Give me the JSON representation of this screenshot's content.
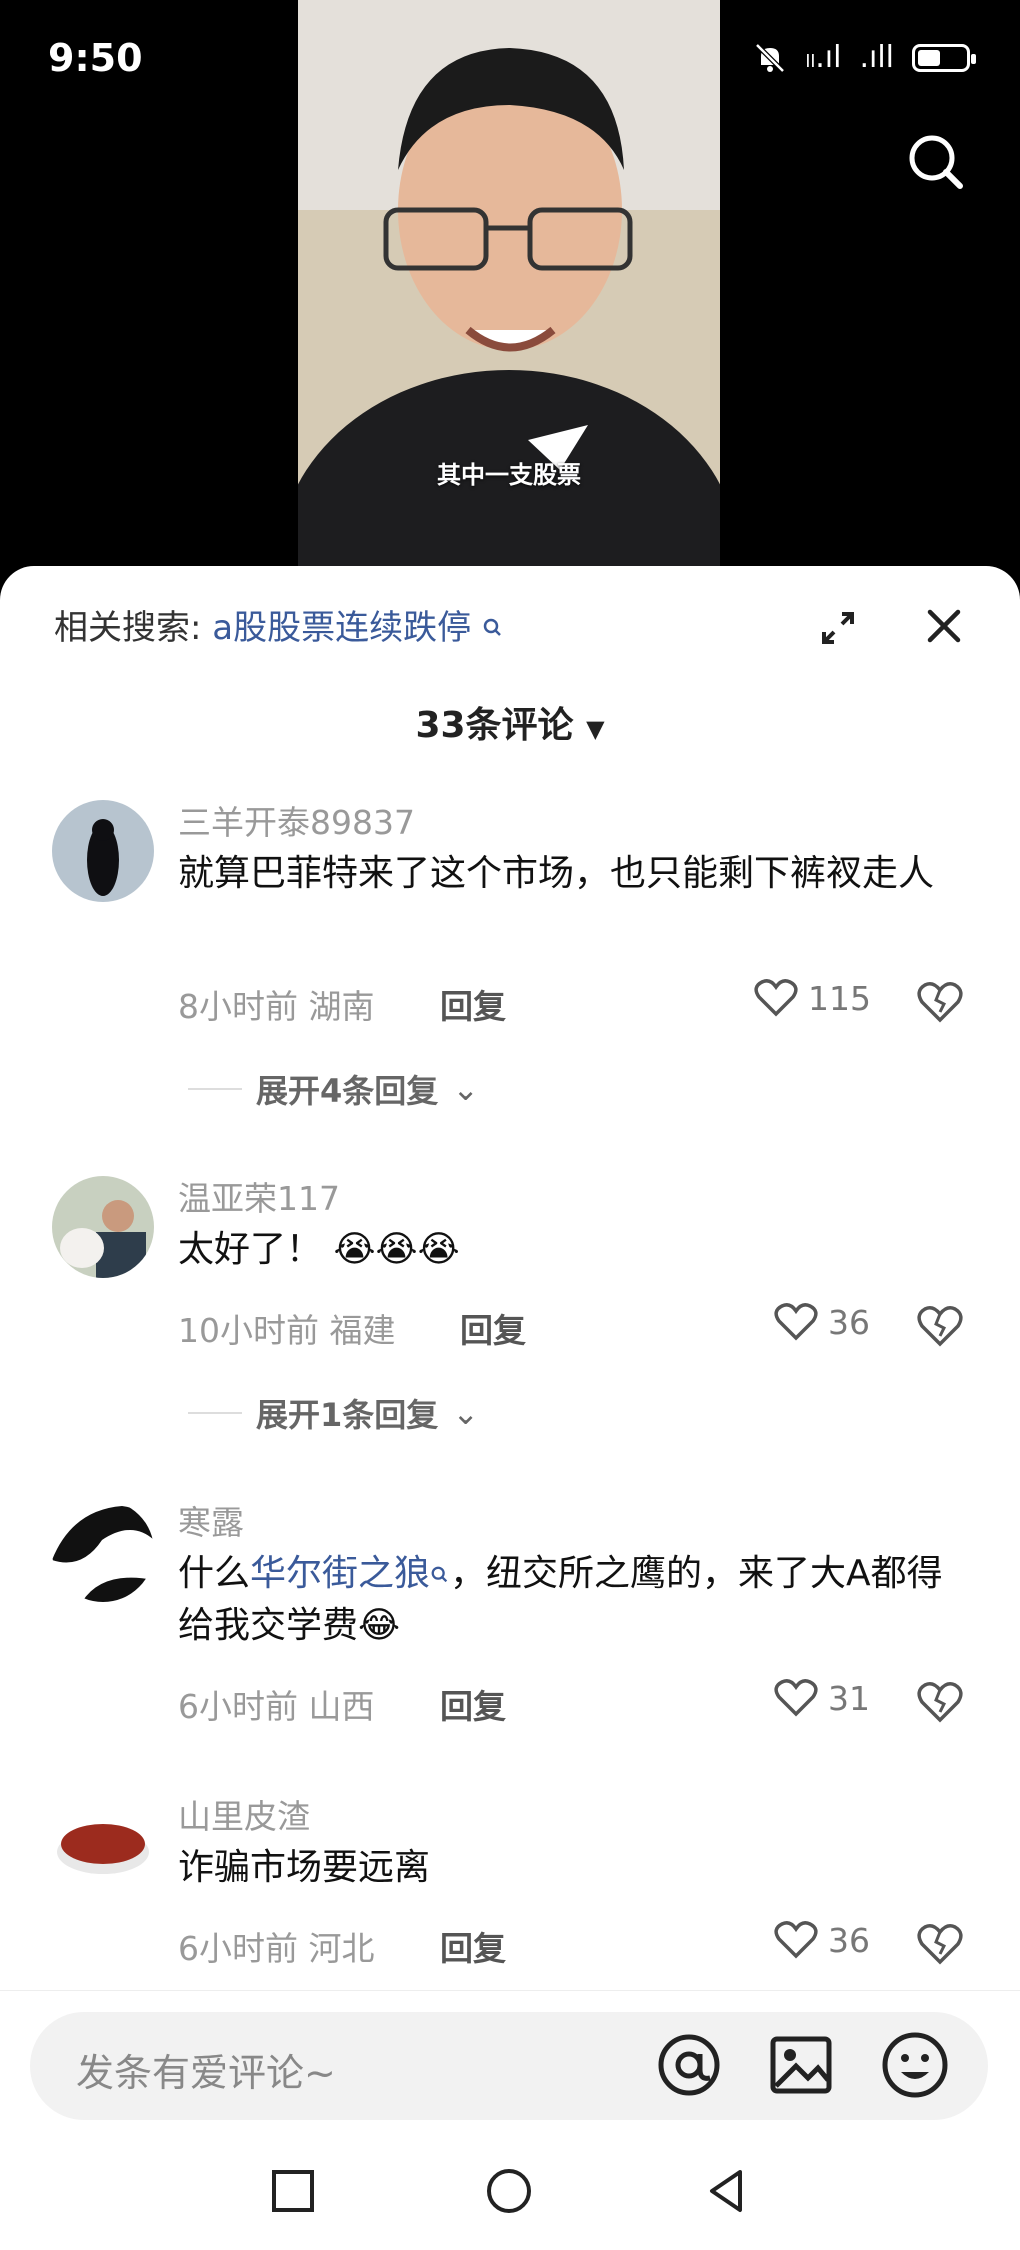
{
  "status_bar": {
    "time": "9:50",
    "signal1": "ₗₗ.ıl",
    "signal2": ".ıll"
  },
  "video": {
    "subtitle": "其中一支股票"
  },
  "sheet": {
    "related_label": "相关搜索:",
    "related_link": "a股股票连续跌停",
    "comment_count": "33条评论"
  },
  "comments": [
    {
      "user": "三羊开泰89837",
      "text": "就算巴菲特来了这个市场，也只能剩下裤衩走人",
      "time": "8小时前",
      "region": "湖南",
      "reply": "回复",
      "likes": "115",
      "expand": "展开4条回复"
    },
    {
      "user": "温亚荣117",
      "text": "太好了！",
      "emoji": "😭😭😭",
      "time": "10小时前",
      "region": "福建",
      "reply": "回复",
      "likes": "36",
      "expand": "展开1条回复"
    },
    {
      "user": "寒露",
      "text_a": "什么",
      "text_link": "华尔街之狼",
      "text_b": "，纽交所之鹰的，来了大A都得给我交学费😂",
      "time": "6小时前",
      "region": "山西",
      "reply": "回复",
      "likes": "31"
    },
    {
      "user": "山里皮渣",
      "text": "诈骗市场要远离",
      "time": "6小时前",
      "region": "河北",
      "reply": "回复",
      "likes": "36"
    }
  ],
  "input": {
    "placeholder": "发条有爱评论~"
  },
  "colors": {
    "link": "#3a5a9a",
    "muted": "#999999",
    "background": "#ffffff"
  }
}
